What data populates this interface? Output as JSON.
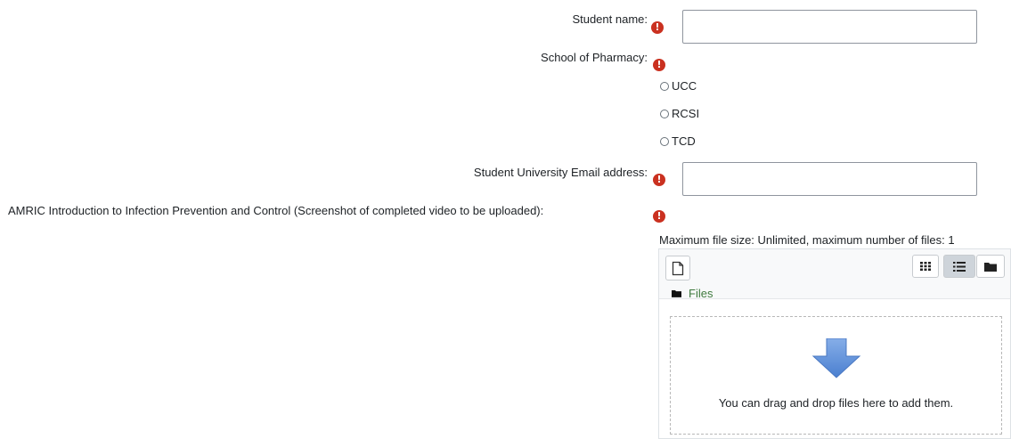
{
  "form": {
    "student_name": {
      "label": "Student name:",
      "value": ""
    },
    "school": {
      "label": "School of Pharmacy:",
      "options": [
        "UCC",
        "RCSI",
        "TCD"
      ]
    },
    "email": {
      "label": "Student University Email address:",
      "value": ""
    },
    "upload": {
      "label": "AMRIC Introduction to Infection Prevention and Control (Screenshot of completed video to be uploaded):",
      "limits": "Maximum file size: Unlimited, maximum number of files: 1",
      "path_label": "Files",
      "dropzone_text": "You can drag and drop files here to add them."
    }
  },
  "icons": {
    "required": "exclamation-circle-icon",
    "add_file": "file-icon",
    "view_icons": "grid-icon",
    "view_list": "list-icon",
    "view_tree": "folder-icon",
    "folder": "folder-icon",
    "upload_arrow": "arrow-down-icon"
  },
  "colors": {
    "required": "#ca3120",
    "arrow": "#5b8dd9",
    "link": "#0f6cbf"
  }
}
